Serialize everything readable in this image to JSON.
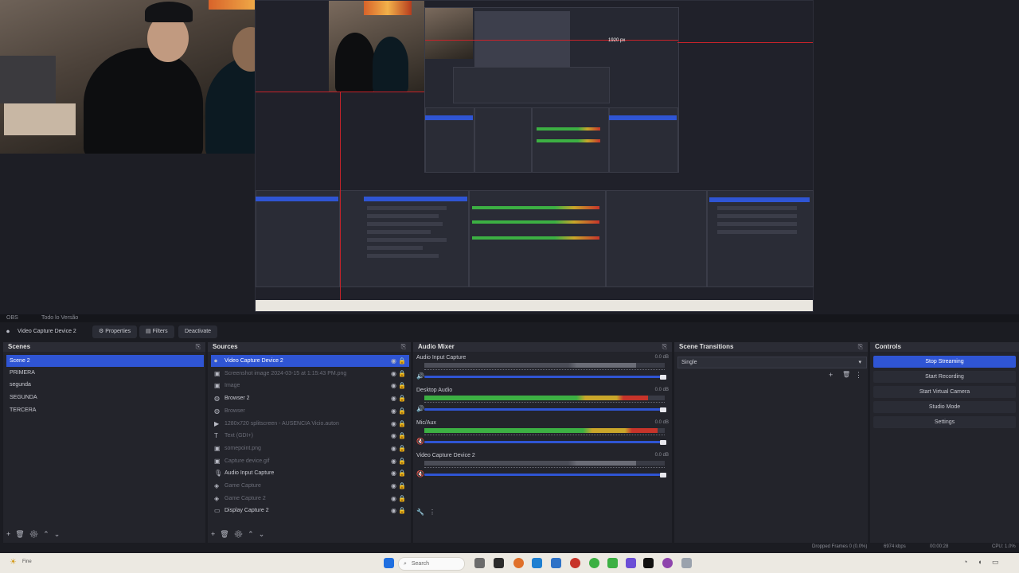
{
  "preview": {
    "nested_label": "1920 px"
  },
  "topstrip": {
    "items": [
      "OBS",
      "Todo lo Versão"
    ]
  },
  "toolbar": {
    "source_name": "Video Capture Device 2",
    "properties": "Properties",
    "filters": "Filters",
    "deactivate": "Deactivate"
  },
  "scenes": {
    "title": "Scenes",
    "items": [
      "Scene 2",
      "PRIMERA",
      "segunda",
      "SEGUNDA",
      "TERCERA"
    ],
    "selected_index": 0
  },
  "sources": {
    "title": "Sources",
    "items": [
      {
        "name": "Video Capture Device 2",
        "icon": "camera-icon",
        "dim": false
      },
      {
        "name": "Screenshot image 2024-03-15 at 1:15:43 PM.png",
        "icon": "image-icon",
        "dim": true
      },
      {
        "name": "Image",
        "icon": "image-icon",
        "dim": true
      },
      {
        "name": "Browser 2",
        "icon": "globe-icon",
        "dim": false
      },
      {
        "name": "Browser",
        "icon": "globe-icon",
        "dim": true
      },
      {
        "name": "1280x720 splitscreen - AUSENCIA Vicio.auton",
        "icon": "play-icon",
        "dim": true
      },
      {
        "name": "Text (GDI+)",
        "icon": "text-icon",
        "dim": true
      },
      {
        "name": "somepoint.png",
        "icon": "image-icon",
        "dim": true
      },
      {
        "name": "Capture device.gif",
        "icon": "image-icon",
        "dim": true
      },
      {
        "name": "Audio Input Capture",
        "icon": "mic-icon",
        "dim": false
      },
      {
        "name": "Game Capture",
        "icon": "gamepad-icon",
        "dim": true
      },
      {
        "name": "Game Capture 2",
        "icon": "gamepad-icon",
        "dim": true
      },
      {
        "name": "Display Capture 2",
        "icon": "monitor-icon",
        "dim": false
      }
    ],
    "selected_index": 0
  },
  "mixer": {
    "title": "Audio Mixer",
    "channels": [
      {
        "name": "Audio Input Capture",
        "db": "0.0 dB",
        "level": 0.0,
        "muted": false
      },
      {
        "name": "Desktop Audio",
        "db": "0.0 dB",
        "level": 0.93,
        "muted": false
      },
      {
        "name": "Mic/Aux",
        "db": "0.0 dB",
        "level": 0.97,
        "muted": true
      },
      {
        "name": "Video Capture Device 2",
        "db": "0.0 dB",
        "level": 0.0,
        "muted": true
      }
    ]
  },
  "transitions": {
    "title": "Scene Transitions",
    "selected": "Single"
  },
  "controls": {
    "title": "Controls",
    "buttons": [
      "Stop Streaming",
      "Start Recording",
      "Start Virtual Camera",
      "Studio Mode",
      "Settings"
    ],
    "active_index": 0
  },
  "status": {
    "dropped": "Dropped Frames 0 (0.0%)",
    "bitrate": "6974 kbps",
    "time": "00:00:28",
    "cpu": "CPU: 1.0%"
  },
  "taskbar": {
    "search_placeholder": "Search",
    "weather": "Fine"
  },
  "colors": {
    "accent": "#2f55d4",
    "green": "#3cb043",
    "yellow": "#c9a62a",
    "red": "#c7342a"
  }
}
